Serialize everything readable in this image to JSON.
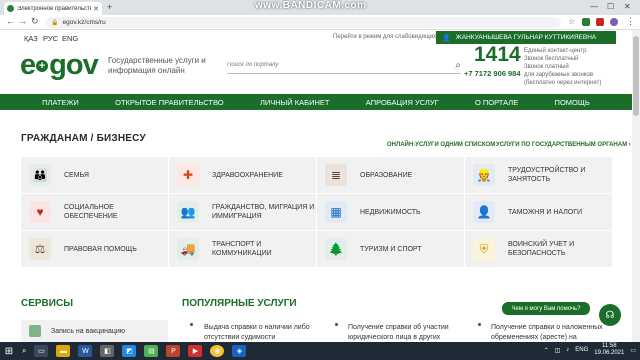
{
  "browser": {
    "tab_title": "Электронное правительство Ре",
    "url": "egov.kz/cms/ru",
    "recorder_watermark": "www.BANDICAM.com"
  },
  "header": {
    "languages": [
      "ҚАЗ",
      "РУС",
      "ENG"
    ],
    "impaired_link": "Перейти в режим для слабовидящих",
    "user_name": "ЖАНКУАНЫШЕВА ГУЛЬНАР КУТТИКИЯЕВНА",
    "logo_text_left": "e",
    "logo_text_right": "gov",
    "tagline": "Государственные услуги и информация онлайн",
    "search_placeholder": "Поиск по порталу",
    "phone_short": "1414",
    "phone_long": "+7 7172 906 984",
    "contact_lines": [
      "Единый контакт-центр",
      "Звонок бесплатный",
      "Звонок платный",
      "для зарубежных звонков",
      "(бесплатно через интернет)"
    ]
  },
  "nav": [
    "ПЛАТЕЖИ",
    "ОТКРЫТОЕ ПРАВИТЕЛЬСТВО",
    "ЛИЧНЫЙ КАБИНЕТ",
    "АПРОБАЦИЯ УСЛУГ",
    "О ПОРТАЛЕ",
    "ПОМОЩЬ"
  ],
  "section": {
    "title": "ГРАЖДАНАМ / БИЗНЕСУ",
    "link_online": "ОНЛАЙН-УСЛУГИ ОДНИМ СПИСКОМ",
    "link_agencies": "УСЛУГИ ПО ГОСУДАРСТВЕННЫМ ОРГАНАМ"
  },
  "categories": [
    {
      "label": "СЕМЬЯ",
      "icon": "family-icon"
    },
    {
      "label": "ЗДРАВООХРАНЕНИЕ",
      "icon": "health-icon"
    },
    {
      "label": "ОБРАЗОВАНИЕ",
      "icon": "books-icon"
    },
    {
      "label": "ТРУДОУСТРОЙСТВО И ЗАНЯТОСТЬ",
      "icon": "worker-icon"
    },
    {
      "label": "СОЦИАЛЬНОЕ ОБЕСПЕЧЕНИЕ",
      "icon": "social-icon"
    },
    {
      "label": "ГРАЖДАНСТВО, МИГРАЦИЯ И ИММИГРАЦИЯ",
      "icon": "citizenship-icon"
    },
    {
      "label": "НЕДВИЖИМОСТЬ",
      "icon": "building-icon"
    },
    {
      "label": "ТАМОЖНЯ И НАЛОГИ",
      "icon": "customs-icon"
    },
    {
      "label": "ПРАВОВАЯ ПОМОЩЬ",
      "icon": "legal-icon"
    },
    {
      "label": "ТРАНСПОРТ И КОММУНИКАЦИИ",
      "icon": "truck-icon"
    },
    {
      "label": "ТУРИЗМ И СПОРТ",
      "icon": "tourism-icon"
    },
    {
      "label": "ВОИНСКИЙ УЧЕТ И БЕЗОПАСНОСТЬ",
      "icon": "shield-icon"
    }
  ],
  "services": {
    "title": "СЕРВИСЫ",
    "item": "Запись на вакцинацию"
  },
  "popular": {
    "title": "ПОПУЛЯРНЫЕ УСЛУГИ",
    "items": [
      "Выдача справки о наличии либо отсутствии судимости",
      "Получение справки об участии юридического лица в других",
      "Получение справки о наложенных обременениях (аресте) на"
    ]
  },
  "chat": {
    "bubble": "Чем я могу Вам помочь?"
  },
  "taskbar": {
    "lang": "ENG",
    "time": "11:58",
    "date": "19.06.2021"
  },
  "colors": {
    "brand": "#1b6e2a",
    "tile": "#f1f1f1"
  }
}
